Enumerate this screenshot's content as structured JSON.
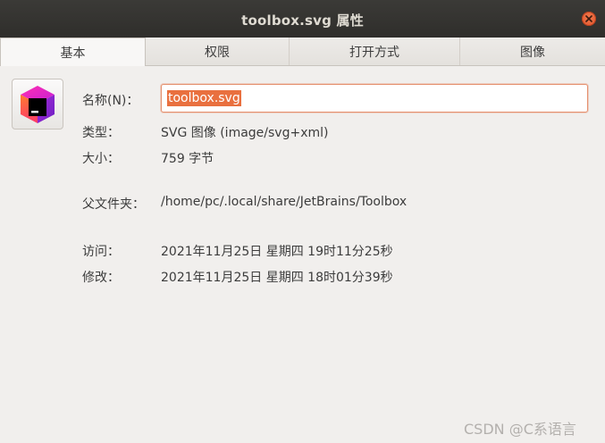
{
  "window": {
    "title": "toolbox.svg 属性"
  },
  "tabs": [
    {
      "label": "基本",
      "active": true
    },
    {
      "label": "权限",
      "active": false
    },
    {
      "label": "打开方式",
      "active": false
    },
    {
      "label": "图像",
      "active": false
    }
  ],
  "file": {
    "icon": "jetbrains-toolbox-icon",
    "name_label": "名称(N)：",
    "name_value": "toolbox.svg",
    "type_label": "类型：",
    "type_value": "SVG 图像 (image/svg+xml)",
    "size_label": "大小：",
    "size_value": "759 字节",
    "folder_label": "父文件夹：",
    "folder_value": "/home/pc/.local/share/JetBrains/Toolbox",
    "accessed_label": "访问：",
    "accessed_value": "2021年11月25日 星期四 19时11分25秒",
    "modified_label": "修改：",
    "modified_value": "2021年11月25日 星期四 18时01分39秒"
  },
  "watermark": "CSDN @C系语言",
  "colors": {
    "accent": "#e9703f",
    "close": "#e0512a",
    "titlebar": "#2f2e2b"
  }
}
